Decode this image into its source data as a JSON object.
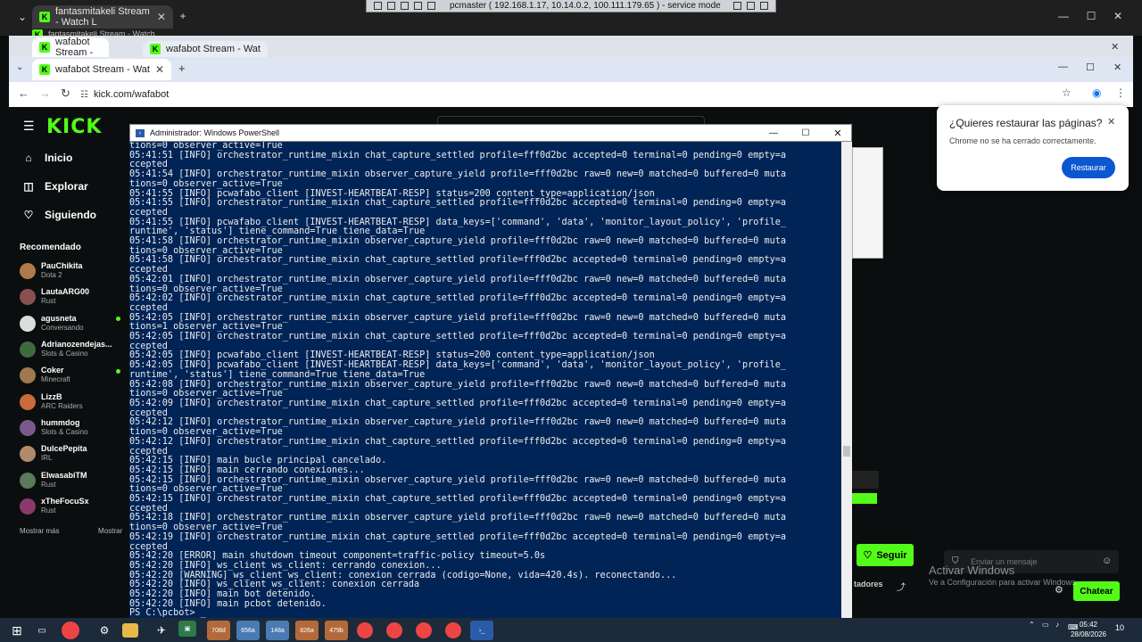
{
  "remote_banner": {
    "title": "pcmaster ( 192.168.1.17, 10.14.0.2, 100.111.179.65 ) - service mode"
  },
  "browser_top": {
    "tab1": "fantasmitakeli Stream - Watch L",
    "tab2": "fantasmitakeli Stream - Watch"
  },
  "browser_mid": {
    "tab1": "wafabot Stream - ",
    "tab2": "wafabot Stream - Watch Live o"
  },
  "browser_front": {
    "tab": "wafabot Stream - Watch Live o",
    "url": "kick.com/wafabot"
  },
  "kick": {
    "logo": "KICK",
    "nav": [
      "Inicio",
      "Explorar",
      "Siguiendo"
    ],
    "recommended_heading": "Recomendado",
    "channels": [
      {
        "name": "PauChikita",
        "cat": "Dota 2"
      },
      {
        "name": "LautaARG00",
        "cat": "Rust"
      },
      {
        "name": "agusneta",
        "cat": "Conversando"
      },
      {
        "name": "Adrianozendejas...",
        "cat": "Slots & Casino"
      },
      {
        "name": "Coker",
        "cat": "Minecraft"
      },
      {
        "name": "LizzB",
        "cat": "ARC Raiders"
      },
      {
        "name": "hummdog",
        "cat": "Slots & Casino"
      },
      {
        "name": "DulcePepita",
        "cat": "IRL"
      },
      {
        "name": "ElwasabiTM",
        "cat": "Rust"
      },
      {
        "name": "xTheFocuSx",
        "cat": "Rust"
      }
    ],
    "show_more": "Mostrar más",
    "show_more2": "Mostrar",
    "follow": "Seguir",
    "chat_placeholder": "Enviar un mensaje",
    "chat_button": "Chatear",
    "viewers_partial": "tadores"
  },
  "restore_popup": {
    "title": "¿Quieres restaurar las páginas?",
    "text": "Chrome no se ha cerrado correctamente.",
    "button": "Restaurar"
  },
  "activate_windows": {
    "line1": "Activar Windows",
    "line2": "Ve a Configuración para activar Windows."
  },
  "powershell": {
    "title": "Administrador: Windows PowerShell",
    "lines": [
      "tions=0 observer_active=True",
      "05:41:51 [INFO] orchestrator_runtime_mixin chat_capture_settled profile=fff0d2bc accepted=0 terminal=0 pending=0 empty=a",
      "ccepted",
      "05:41:54 [INFO] orchestrator_runtime_mixin observer_capture_yield profile=fff0d2bc raw=0 new=0 matched=0 buffered=0 muta",
      "tions=0 observer_active=True",
      "05:41:55 [INFO] pcwafabo_client [INVEST-HEARTBEAT-RESP] status=200 content_type=application/json",
      "05:41:55 [INFO] orchestrator_runtime_mixin chat_capture_settled profile=fff0d2bc accepted=0 terminal=0 pending=0 empty=a",
      "ccepted",
      "05:41:55 [INFO] pcwafabo_client [INVEST-HEARTBEAT-RESP] data_keys=['command', 'data', 'monitor_layout_policy', 'profile_",
      "runtime', 'status'] tiene_command=True tiene_data=True",
      "05:41:58 [INFO] orchestrator_runtime_mixin observer_capture_yield profile=fff0d2bc raw=0 new=0 matched=0 buffered=0 muta",
      "tions=0 observer_active=True",
      "05:41:58 [INFO] orchestrator_runtime_mixin chat_capture_settled profile=fff0d2bc accepted=0 terminal=0 pending=0 empty=a",
      "ccepted",
      "05:42:01 [INFO] orchestrator_runtime_mixin observer_capture_yield profile=fff0d2bc raw=0 new=0 matched=0 buffered=0 muta",
      "tions=0 observer_active=True",
      "05:42:02 [INFO] orchestrator_runtime_mixin chat_capture_settled profile=fff0d2bc accepted=0 terminal=0 pending=0 empty=a",
      "ccepted",
      "05:42:05 [INFO] orchestrator_runtime_mixin observer_capture_yield profile=fff0d2bc raw=0 new=0 matched=0 buffered=0 muta",
      "tions=1 observer_active=True",
      "05:42:05 [INFO] orchestrator_runtime_mixin chat_capture_settled profile=fff0d2bc accepted=0 terminal=0 pending=0 empty=a",
      "ccepted",
      "05:42:05 [INFO] pcwafabo_client [INVEST-HEARTBEAT-RESP] status=200 content_type=application/json",
      "05:42:05 [INFO] pcwafabo_client [INVEST-HEARTBEAT-RESP] data_keys=['command', 'data', 'monitor_layout_policy', 'profile_",
      "runtime', 'status'] tiene_command=True tiene_data=True",
      "05:42:08 [INFO] orchestrator_runtime_mixin observer_capture_yield profile=fff0d2bc raw=0 new=0 matched=0 buffered=0 muta",
      "tions=0 observer_active=True",
      "05:42:09 [INFO] orchestrator_runtime_mixin chat_capture_settled profile=fff0d2bc accepted=0 terminal=0 pending=0 empty=a",
      "ccepted",
      "05:42:12 [INFO] orchestrator_runtime_mixin observer_capture_yield profile=fff0d2bc raw=0 new=0 matched=0 buffered=0 muta",
      "tions=0 observer_active=True",
      "05:42:12 [INFO] orchestrator_runtime_mixin chat_capture_settled profile=fff0d2bc accepted=0 terminal=0 pending=0 empty=a",
      "ccepted",
      "05:42:15 [INFO] main bucle principal cancelado.",
      "05:42:15 [INFO] main cerrando conexiones...",
      "05:42:15 [INFO] orchestrator_runtime_mixin observer_capture_yield profile=fff0d2bc raw=0 new=0 matched=0 buffered=0 muta",
      "tions=0 observer_active=True",
      "05:42:15 [INFO] orchestrator_runtime_mixin chat_capture_settled profile=fff0d2bc accepted=0 terminal=0 pending=0 empty=a",
      "ccepted",
      "05:42:18 [INFO] orchestrator_runtime_mixin observer_capture_yield profile=fff0d2bc raw=0 new=0 matched=0 buffered=0 muta",
      "tions=0 observer_active=True",
      "05:42:19 [INFO] orchestrator_runtime_mixin chat_capture_settled profile=fff0d2bc accepted=0 terminal=0 pending=0 empty=a",
      "ccepted",
      "05:42:20 [ERROR] main shutdown timeout component=traffic-policy timeout=5.0s",
      "05:42:20 [INFO] ws_client ws_client: cerrando conexion...",
      "05:42:20 [WARNING] ws_client ws_client: conexion cerrada (codigo=None, vida=420.4s). reconectando...",
      "05:42:20 [INFO] ws_client ws_client: conexion cerrada",
      "05:42:20 [INFO] main bot detenido.",
      "05:42:20 [INFO] main pcbot detenido.",
      "PS C:\\pcbot> _"
    ]
  },
  "taskbar": {
    "pinned": [
      "708d",
      "656a",
      "148a",
      "826a",
      "479b"
    ],
    "time": "05:42",
    "date": "28/08/2026",
    "notif": "10"
  }
}
